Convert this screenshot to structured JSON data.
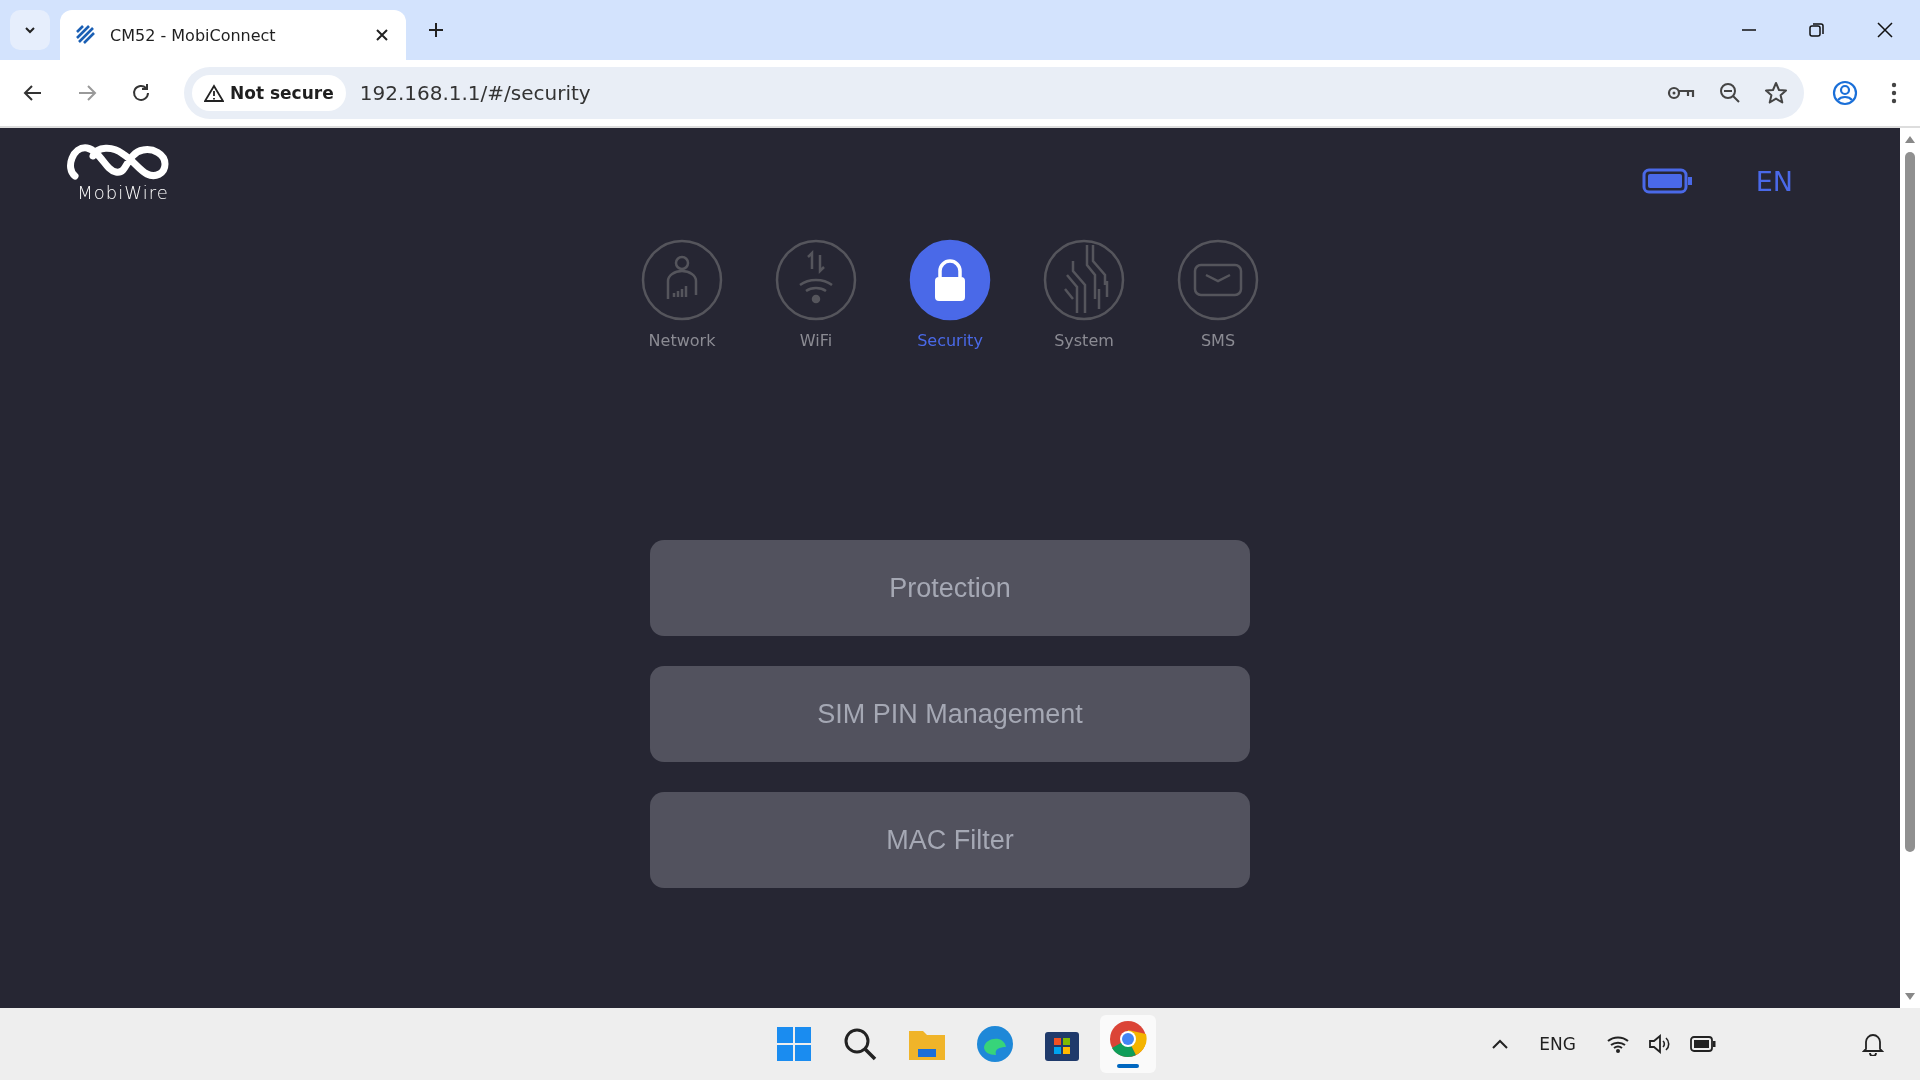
{
  "browser": {
    "tab_title": "CM52 - MobiConnect",
    "security_label": "Not secure",
    "url": "192.168.1.1/#/security"
  },
  "header": {
    "logo_text": "MobiWire",
    "language": "EN"
  },
  "nav": [
    {
      "label": "Network",
      "kind": "network",
      "selected": false
    },
    {
      "label": "WiFi",
      "kind": "wifi",
      "selected": false
    },
    {
      "label": "Security",
      "kind": "security",
      "selected": true
    },
    {
      "label": "System",
      "kind": "system",
      "selected": false
    },
    {
      "label": "SMS",
      "kind": "sms",
      "selected": false
    }
  ],
  "menu": [
    "Protection",
    "SIM PIN Management",
    "MAC Filter"
  ],
  "taskbar": {
    "language": "ENG"
  }
}
